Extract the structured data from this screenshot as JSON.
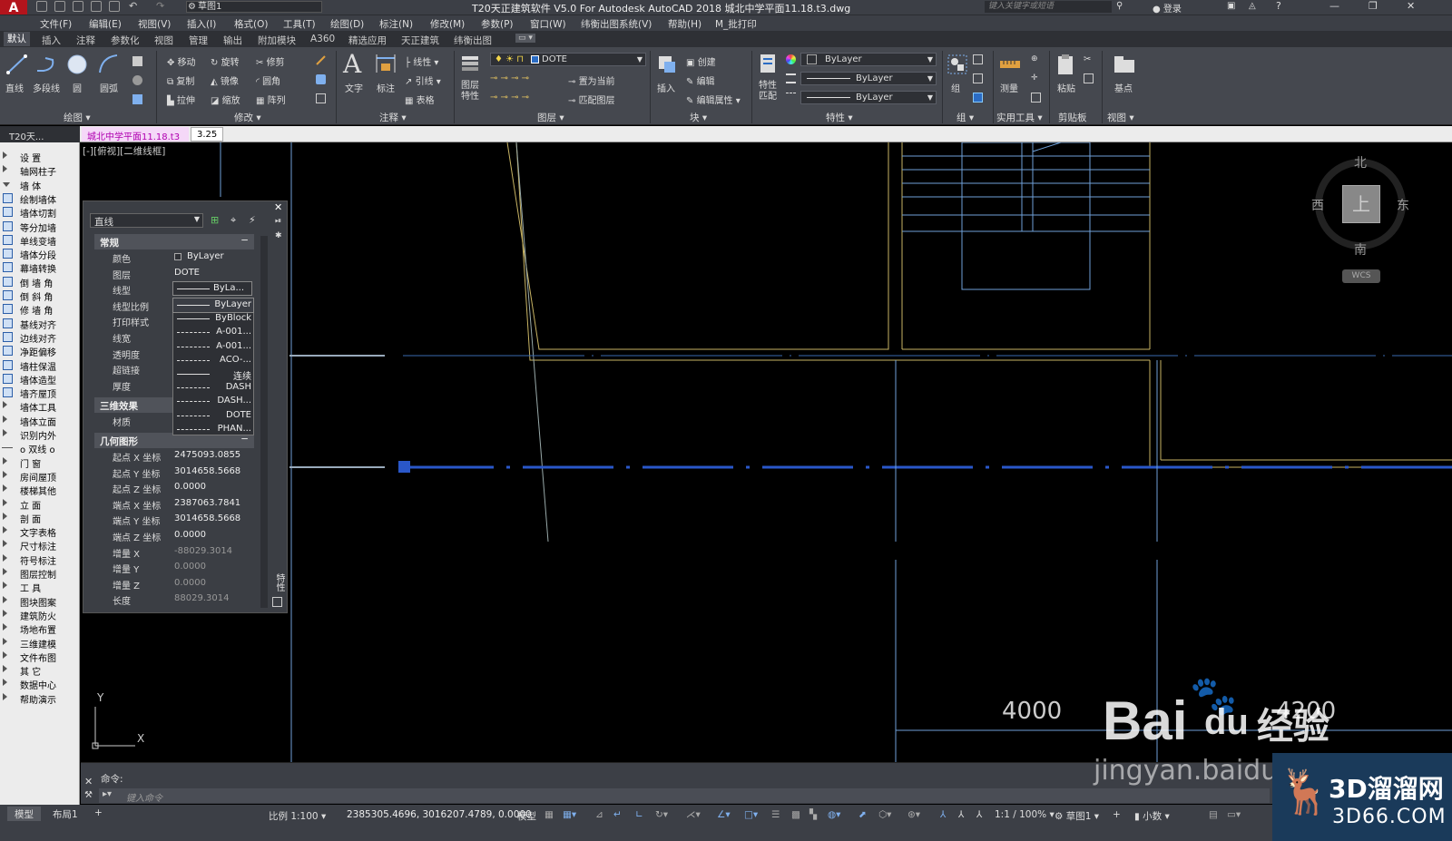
{
  "app": {
    "logo": "A",
    "window_title": "T20天正建筑软件 V5.0 For Autodesk AutoCAD 2018    城北中学平面11.18.t3.dwg",
    "workspace": "草图1",
    "search_placeholder": "键入关键字或短语",
    "login": "登录"
  },
  "menu": [
    "文件(F)",
    "编辑(E)",
    "视图(V)",
    "插入(I)",
    "格式(O)",
    "工具(T)",
    "绘图(D)",
    "标注(N)",
    "修改(M)",
    "参数(P)",
    "窗口(W)",
    "纬衡出图系统(V)",
    "帮助(H)",
    "M_批打印"
  ],
  "ribbon_tabs": [
    "默认",
    "插入",
    "注释",
    "参数化",
    "视图",
    "管理",
    "输出",
    "附加模块",
    "A360",
    "精选应用",
    "天正建筑",
    "纬衡出图"
  ],
  "ribbon": {
    "draw": {
      "line": "直线",
      "pline": "多段线",
      "circle": "圆",
      "arc": "圆弧",
      "group_label": "绘图"
    },
    "modify": {
      "move": "移动",
      "rotate": "旋转",
      "trim": "修剪",
      "copy": "复制",
      "mirror": "镜像",
      "fillet": "圆角",
      "stretch": "拉伸",
      "scale": "缩放",
      "array": "阵列",
      "group_label": "修改"
    },
    "annotation": {
      "text": "文字",
      "dimension": "标注",
      "linetype": "线性",
      "leader": "引线",
      "table": "表格",
      "group_label": "注释"
    },
    "layers": {
      "layer_props": "图层特性",
      "current_layer": "DOTE",
      "set_current": "置为当前",
      "match_layer": "匹配图层",
      "group_label": "图层"
    },
    "block": {
      "insert": "插入",
      "create": "创建",
      "edit": "编辑",
      "edit_attr": "编辑属性",
      "group_label": "块"
    },
    "properties": {
      "match": "特性匹配",
      "color": "ByLayer",
      "linetype": "ByLayer",
      "lineweight": "ByLayer",
      "group_label": "特性"
    },
    "groups": {
      "group": "组",
      "group_label": "组"
    },
    "utilities": {
      "measure": "测量",
      "group_label": "实用工具"
    },
    "clipboard": {
      "paste": "粘贴",
      "group_label": "剪贴板"
    },
    "view": {
      "base": "基点",
      "group_label": "视图"
    }
  },
  "doc_tabs": {
    "t20": "T20天...",
    "active": "城北中学平面11.18.t3",
    "second": "3.25"
  },
  "left_menu": [
    {
      "label": "设    置",
      "type": "arrow"
    },
    {
      "label": "轴网柱子",
      "type": "arrow"
    },
    {
      "label": "墙    体",
      "type": "down"
    },
    {
      "label": "绘制墙体",
      "type": "icon"
    },
    {
      "label": "墙体切割",
      "type": "icon"
    },
    {
      "label": "等分加墙",
      "type": "icon"
    },
    {
      "label": "单线变墙",
      "type": "icon"
    },
    {
      "label": "墙体分段",
      "type": "icon"
    },
    {
      "label": "幕墙转换",
      "type": "icon"
    },
    {
      "label": "倒 墙 角",
      "type": "icon"
    },
    {
      "label": "倒 斜 角",
      "type": "icon"
    },
    {
      "label": "修 墙 角",
      "type": "icon"
    },
    {
      "label": "基线对齐",
      "type": "icon"
    },
    {
      "label": "边线对齐",
      "type": "icon"
    },
    {
      "label": "净距偏移",
      "type": "icon"
    },
    {
      "label": "墙柱保温",
      "type": "icon"
    },
    {
      "label": "墙体造型",
      "type": "icon"
    },
    {
      "label": "墙齐屋顶",
      "type": "icon"
    },
    {
      "label": "墙体工具",
      "type": "arrow"
    },
    {
      "label": "墙体立面",
      "type": "arrow"
    },
    {
      "label": "识别内外",
      "type": "arrow"
    },
    {
      "label": "o 双线 o",
      "type": "bar"
    },
    {
      "label": "门    窗",
      "type": "arrow"
    },
    {
      "label": "房间屋顶",
      "type": "arrow"
    },
    {
      "label": "楼梯其他",
      "type": "arrow"
    },
    {
      "label": "立    面",
      "type": "arrow"
    },
    {
      "label": "剖    面",
      "type": "arrow"
    },
    {
      "label": "文字表格",
      "type": "arrow"
    },
    {
      "label": "尺寸标注",
      "type": "arrow"
    },
    {
      "label": "符号标注",
      "type": "arrow"
    },
    {
      "label": "图层控制",
      "type": "arrow"
    },
    {
      "label": "工    具",
      "type": "arrow"
    },
    {
      "label": "图块图案",
      "type": "arrow"
    },
    {
      "label": "建筑防火",
      "type": "arrow"
    },
    {
      "label": "场地布置",
      "type": "arrow"
    },
    {
      "label": "三维建模",
      "type": "arrow"
    },
    {
      "label": "文件布图",
      "type": "arrow"
    },
    {
      "label": "其    它",
      "type": "arrow"
    },
    {
      "label": "数据中心",
      "type": "arrow"
    },
    {
      "label": "帮助演示",
      "type": "arrow"
    }
  ],
  "viewport_label": "[-][俯视][二维线框]",
  "viewcube": {
    "north": "北",
    "south": "南",
    "east": "东",
    "west": "西",
    "top": "上",
    "wcs": "WCS"
  },
  "ucs": {
    "x": "X",
    "y": "Y"
  },
  "dimensions": [
    "4000",
    "4200"
  ],
  "properties": {
    "object_type": "直线",
    "side_label": "特性",
    "sections": {
      "general": "常规",
      "3d": "三维效果",
      "geometry": "几何图形"
    },
    "general": [
      {
        "key": "颜色",
        "value": "ByLayer"
      },
      {
        "key": "图层",
        "value": "DOTE"
      },
      {
        "key": "线型",
        "value": "ByLa..."
      },
      {
        "key": "线型比例",
        "value": ""
      },
      {
        "key": "打印样式",
        "value": ""
      },
      {
        "key": "线宽",
        "value": ""
      },
      {
        "key": "透明度",
        "value": ""
      },
      {
        "key": "超链接",
        "value": ""
      },
      {
        "key": "厚度",
        "value": ""
      }
    ],
    "effects3d": [
      {
        "key": "材质",
        "value": ""
      }
    ],
    "geometry": [
      {
        "key": "起点 X 坐标",
        "value": "2475093.0855"
      },
      {
        "key": "起点 Y 坐标",
        "value": "3014658.5668"
      },
      {
        "key": "起点 Z 坐标",
        "value": "0.0000"
      },
      {
        "key": "端点 X 坐标",
        "value": "2387063.7841"
      },
      {
        "key": "端点 Y 坐标",
        "value": "3014658.5668"
      },
      {
        "key": "端点 Z 坐标",
        "value": "0.0000"
      },
      {
        "key": "增量 X",
        "value": "-88029.3014"
      },
      {
        "key": "增量 Y",
        "value": "0.0000"
      },
      {
        "key": "增量 Z",
        "value": "0.0000"
      },
      {
        "key": "长度",
        "value": "88029.3014"
      }
    ],
    "linetype_options": [
      {
        "label": "ByLayer",
        "style": "solid"
      },
      {
        "label": "ByBlock",
        "style": "solid"
      },
      {
        "label": "A-001...",
        "style": "dash"
      },
      {
        "label": "A-001...",
        "style": "dash"
      },
      {
        "label": "ACO-...",
        "style": "dash"
      },
      {
        "label": "连续",
        "style": "solid"
      },
      {
        "label": "DASH",
        "style": "dash"
      },
      {
        "label": "DASH...",
        "style": "dash"
      },
      {
        "label": "DOTE",
        "style": "dash"
      },
      {
        "label": "PHAN...",
        "style": "dash"
      }
    ]
  },
  "command": {
    "history": "命令:",
    "placeholder": "键入命令"
  },
  "status": {
    "model_tab": "模型",
    "layout_tab": "布局1",
    "scale": "比例 1:100",
    "coords": "2385305.4696, 3016207.4789, 0.0000",
    "model": "模型",
    "annotation_scale": "1:1 / 100%",
    "workspace": "草图1",
    "units": "小数"
  },
  "watermark": {
    "brand": "Bai",
    "brand2": "du",
    "suffix": "经验",
    "url": "jingyan.baidu",
    "logo_cn": "3D溜溜网",
    "logo_en": "3D66.COM"
  },
  "colors": {
    "accent": "#2b6cc4",
    "wall_yellow": "#c8b464",
    "cyan_line": "#6fa0d8",
    "selection": "#2a57c9"
  }
}
